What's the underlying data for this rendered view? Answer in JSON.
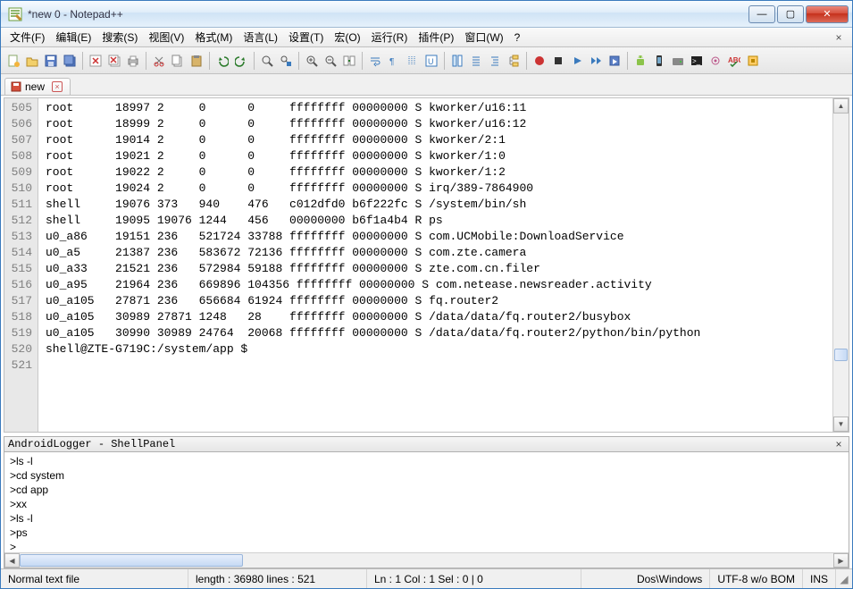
{
  "window": {
    "title": "*new  0 - Notepad++"
  },
  "menu": {
    "items": [
      "文件(F)",
      "编辑(E)",
      "搜索(S)",
      "视图(V)",
      "格式(M)",
      "语言(L)",
      "设置(T)",
      "宏(O)",
      "运行(R)",
      "插件(P)",
      "窗口(W)",
      "?"
    ],
    "close_glyph": "×"
  },
  "tab": {
    "label": "new",
    "close_glyph": "×"
  },
  "editor": {
    "first_line": 505,
    "lines": [
      "root      18997 2     0      0     ffffffff 00000000 S kworker/u16:11",
      "root      18999 2     0      0     ffffffff 00000000 S kworker/u16:12",
      "root      19014 2     0      0     ffffffff 00000000 S kworker/2:1",
      "root      19021 2     0      0     ffffffff 00000000 S kworker/1:0",
      "root      19022 2     0      0     ffffffff 00000000 S kworker/1:2",
      "root      19024 2     0      0     ffffffff 00000000 S irq/389-7864900",
      "shell     19076 373   940    476   c012dfd0 b6f222fc S /system/bin/sh",
      "shell     19095 19076 1244   456   00000000 b6f1a4b4 R ps",
      "u0_a86    19151 236   521724 33788 ffffffff 00000000 S com.UCMobile:DownloadService",
      "u0_a5     21387 236   583672 72136 ffffffff 00000000 S com.zte.camera",
      "u0_a33    21521 236   572984 59188 ffffffff 00000000 S zte.com.cn.filer",
      "u0_a95    21964 236   669896 104356 ffffffff 00000000 S com.netease.newsreader.activity",
      "u0_a105   27871 236   656684 61924 ffffffff 00000000 S fq.router2",
      "u0_a105   30989 27871 1248   28    ffffffff 00000000 S /data/data/fq.router2/busybox",
      "u0_a105   30990 30989 24764  20068 ffffffff 00000000 S /data/data/fq.router2/python/bin/python",
      "shell@ZTE-G719C:/system/app $",
      ""
    ]
  },
  "panel": {
    "title": "AndroidLogger - ShellPanel",
    "lines": [
      ">ls -l",
      ">cd system",
      ">cd app",
      ">xx",
      ">ls -l",
      ">ps",
      ">"
    ]
  },
  "status": {
    "filetype": "Normal text file",
    "length": "length : 36980    lines : 521",
    "pos": "Ln : 1    Col : 1    Sel : 0 | 0",
    "eol": "Dos\\Windows",
    "enc": "UTF-8 w/o BOM",
    "ins": "INS"
  },
  "winbtns": {
    "min": "—",
    "max": "▢",
    "close": "✕"
  },
  "scroll": {
    "up": "▲",
    "down": "▼",
    "left": "◀",
    "right": "▶"
  }
}
